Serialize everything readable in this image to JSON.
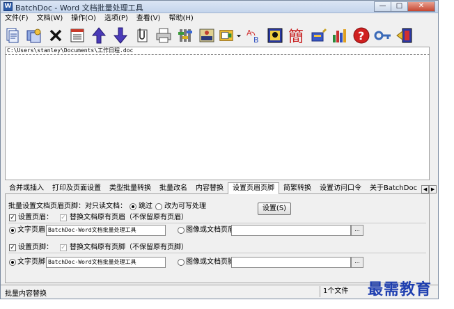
{
  "window": {
    "title": "BatchDoc - Word 文档批量处理工具",
    "min": "—",
    "max": "□",
    "close": "✕"
  },
  "menu": [
    "文件(F)",
    "文档(W)",
    "操作(O)",
    "选项(P)",
    "查看(V)",
    "帮助(H)"
  ],
  "toolbar": {
    "icons": [
      "add-documents-icon",
      "add-folder-icon",
      "remove-icon",
      "clear-list-icon",
      "move-up-icon",
      "move-down-icon",
      "attach-icon",
      "print-icon",
      "settings-icon",
      "rename-icon",
      "type-convert-icon",
      "dropdown-arrow-icon",
      "text-replace-icon",
      "page-setup-icon",
      "simplified-chinese-icon",
      "password-icon",
      "statistics-icon",
      "help-icon",
      "key-icon",
      "exit-icon"
    ],
    "simplified_glyph": "簡"
  },
  "file_list": {
    "items": [
      "C:\\Users\\stanley\\Documents\\工作日程.doc"
    ]
  },
  "tabs": [
    "合并或插入",
    "打印及页面设置",
    "类型批量转换",
    "批量改名",
    "内容替换",
    "设置页眉页脚",
    "简繁转换",
    "设置访问口令",
    "关于BatchDoc"
  ],
  "active_tab": "设置页眉页脚",
  "tab_scroll": {
    "left": "◀",
    "right": "▶"
  },
  "panel": {
    "heading": "批量设置文档页眉页脚：",
    "readonly_label": "对只读文档：",
    "skip_label": "跳过",
    "writable_label": "改为可写处理",
    "set_button": "设置(S)",
    "header": {
      "enable_label": "设置页眉：",
      "replace_label": "替换文档原有页眉（不保留原有页眉）",
      "text_label": "文字页眉",
      "text_value": "BatchDoc-Word文档批量处理工具",
      "image_label": "图像或文档页眉",
      "image_value": "",
      "browse": "..."
    },
    "footer": {
      "enable_label": "设置页脚：",
      "replace_label": "替换文档原有页脚（不保留原有页脚）",
      "text_label": "文字页脚",
      "text_value": "BatchDoc-Word文档批量处理工具",
      "image_label": "图像或文档页脚",
      "image_value": "",
      "browse": "..."
    },
    "check_mark": "✓"
  },
  "status": {
    "left": "批量内容替换",
    "right": "1个文件"
  },
  "watermark": "最需教育"
}
